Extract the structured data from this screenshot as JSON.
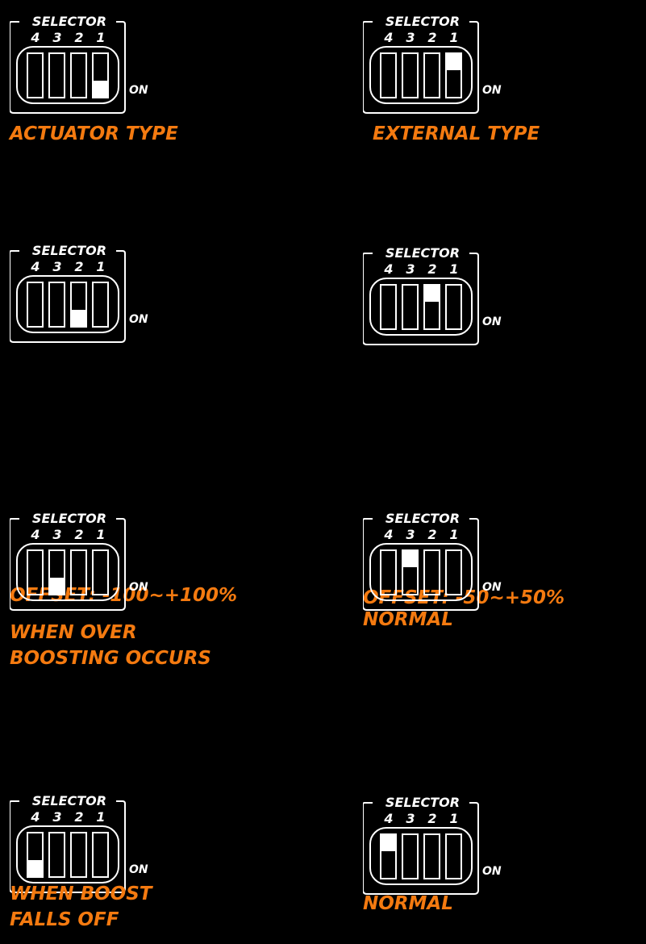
{
  "panels": [
    {
      "selector_label": "SELECTOR",
      "numbers": [
        "4",
        "3",
        "2",
        "1"
      ],
      "on_label": "ON",
      "caption": "ACTUATOR TYPE",
      "active_switch": 1,
      "switch_state": "on"
    },
    {
      "selector_label": "SELECTOR",
      "numbers": [
        "4",
        "3",
        "2",
        "1"
      ],
      "on_label": "ON",
      "caption": "EXTERNAL TYPE",
      "active_switch": 1,
      "switch_state": "off"
    },
    {
      "selector_label": "SELECTOR",
      "numbers": [
        "4",
        "3",
        "2",
        "1"
      ],
      "on_label": "ON",
      "caption": "OFFSET: -100~+100%",
      "active_switch": 2,
      "switch_state": "on"
    },
    {
      "selector_label": "SELECTOR",
      "numbers": [
        "4",
        "3",
        "2",
        "1"
      ],
      "on_label": "ON",
      "caption": "OFFSET: -50~+50%",
      "active_switch": 2,
      "switch_state": "off"
    },
    {
      "selector_label": "SELECTOR",
      "numbers": [
        "4",
        "3",
        "2",
        "1"
      ],
      "on_label": "ON",
      "caption": "WHEN OVER\nBOOSTING OCCURS",
      "active_switch": 3,
      "switch_state": "on"
    },
    {
      "selector_label": "SELECTOR",
      "numbers": [
        "4",
        "3",
        "2",
        "1"
      ],
      "on_label": "ON",
      "caption": "NORMAL",
      "active_switch": 3,
      "switch_state": "off"
    },
    {
      "selector_label": "SELECTOR",
      "numbers": [
        "4",
        "3",
        "2",
        "1"
      ],
      "on_label": "ON",
      "caption": "WHEN BOOST\nFALLS OFF",
      "active_switch": 4,
      "switch_state": "on"
    },
    {
      "selector_label": "SELECTOR",
      "numbers": [
        "4",
        "3",
        "2",
        "1"
      ],
      "on_label": "ON",
      "caption": "NORMAL",
      "active_switch": 4,
      "switch_state": "off"
    }
  ]
}
